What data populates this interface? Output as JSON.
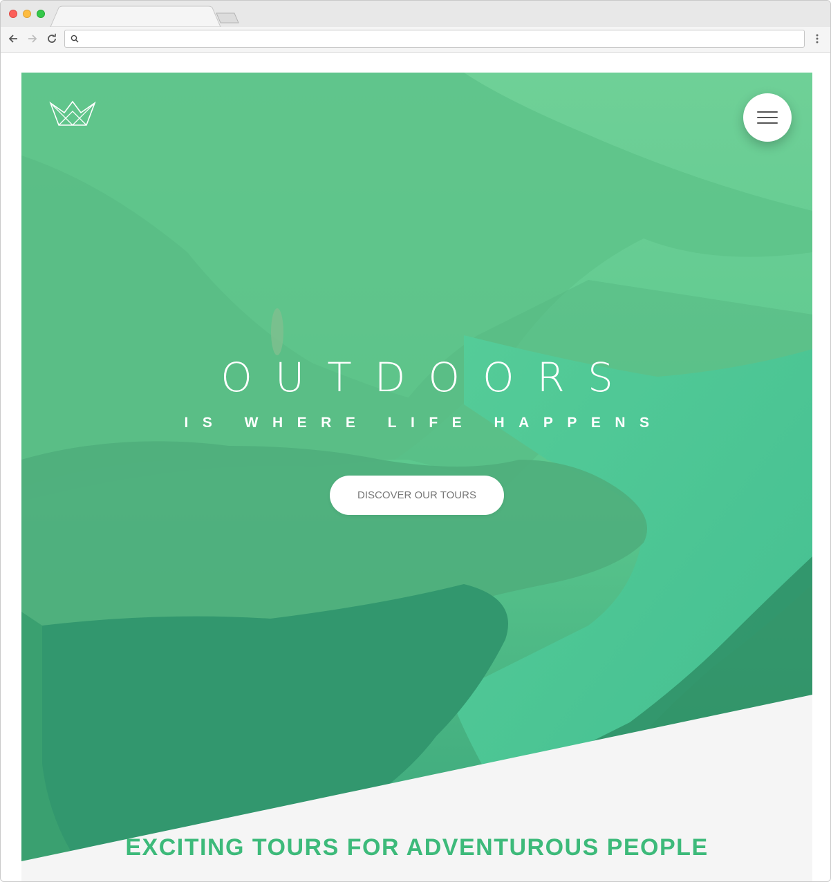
{
  "browser": {
    "address_value": "",
    "address_placeholder": ""
  },
  "hero": {
    "title": "OUTDOORS",
    "subtitle": "IS WHERE LIFE HAPPENS",
    "cta_label": "DISCOVER OUR TOURS"
  },
  "intro": {
    "heading": "EXCITING TOURS FOR ADVENTUROUS PEOPLE"
  },
  "colors": {
    "brand_green": "#3dba7a",
    "overlay_light": "#6fd69a",
    "overlay_dark": "#2f9a70",
    "section_bg": "#f5f5f5",
    "button_text": "#777777"
  },
  "icons": {
    "logo": "crown-logo-icon",
    "menu": "hamburger-menu-icon",
    "back": "back-arrow-icon",
    "forward": "forward-arrow-icon",
    "reload": "reload-icon",
    "search": "search-icon",
    "more": "more-vertical-icon"
  }
}
